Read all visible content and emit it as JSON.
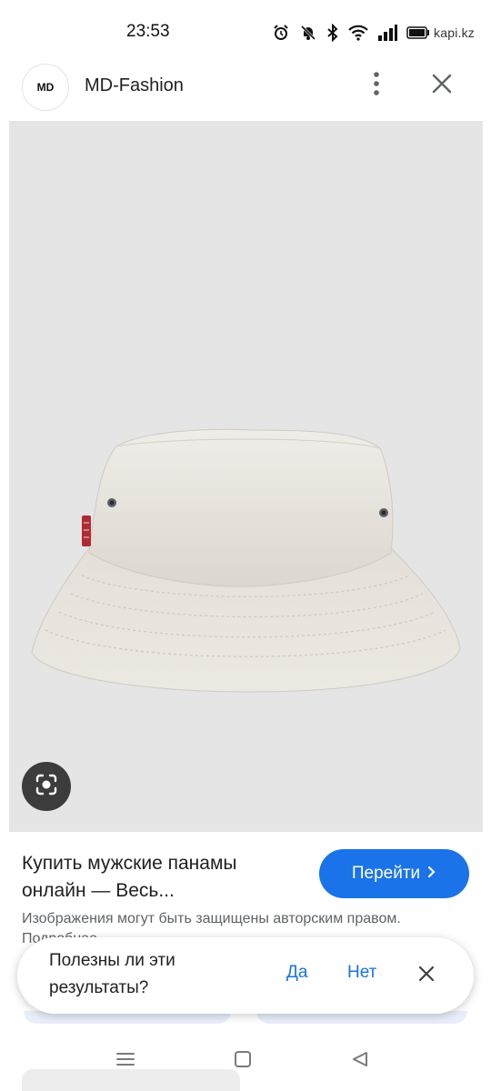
{
  "status_bar": {
    "time": "23:53",
    "icons": [
      "alarm-icon",
      "mute-icon",
      "bluetooth-icon",
      "wifi-icon",
      "signal-icon",
      "battery-icon"
    ],
    "watermark": "kapi.kz"
  },
  "header": {
    "logo_text": "MD",
    "site_name": "MD-Fashion",
    "icons": [
      "more-vert-icon",
      "close-icon"
    ]
  },
  "image": {
    "subject": "bucket-hat",
    "background_color": "#e5e5e6",
    "hat_color": "#ebe7e1",
    "label_color": "#b02a35",
    "lens_icon": "google-lens-icon"
  },
  "result": {
    "title": "Купить мужские панамы онлайн — Весь...",
    "visit_button": "Перейти",
    "visit_icon": "chevron-right-icon",
    "copyright": "Изображения могут быть защищены авторским правом. Подробнее"
  },
  "feedback": {
    "question": "Полезны ли эти результаты?",
    "yes": "Да",
    "no": "Нет",
    "close_icon": "close-icon"
  },
  "nav": {
    "icons": [
      "recent-apps-icon",
      "home-icon",
      "back-icon"
    ]
  },
  "colors": {
    "accent": "#1a73e8",
    "text_primary": "#1f1f1f",
    "text_secondary": "#5f6368"
  }
}
